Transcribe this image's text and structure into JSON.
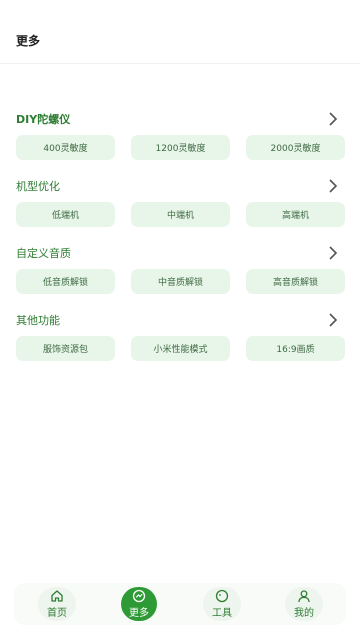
{
  "header": {
    "title": "更多"
  },
  "sections": [
    {
      "title": "DIY陀螺仪",
      "items": [
        "400灵敏度",
        "1200灵敏度",
        "2000灵敏度"
      ]
    },
    {
      "title": "机型优化",
      "items": [
        "低端机",
        "中端机",
        "高端机"
      ]
    },
    {
      "title": "自定义音质",
      "items": [
        "低音质解锁",
        "中音质解锁",
        "高音质解锁"
      ]
    },
    {
      "title": "其他功能",
      "items": [
        "服饰资源包",
        "小米性能模式",
        "16:9画质"
      ]
    }
  ],
  "tabbar": {
    "home": "首页",
    "more": "更多",
    "tools": "工具",
    "mine": "我的",
    "active": "more"
  },
  "colors": {
    "accent": "#2e9a36",
    "chip_bg": "#e8f5e9",
    "title_green": "#2e7d32"
  },
  "icons": {
    "home": "home-icon",
    "more": "compass-icon",
    "tools": "compass-circle-icon",
    "mine": "user-icon",
    "section_arrow": "chevron-right-icon"
  }
}
